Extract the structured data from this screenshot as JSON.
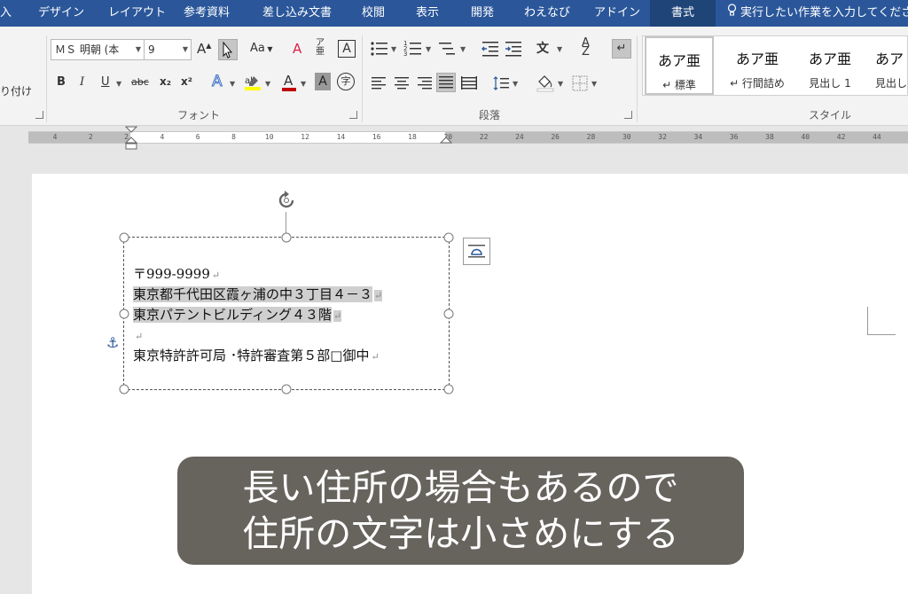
{
  "tabs": [
    "入",
    "デザイン",
    "レイアウト",
    "参考資料",
    "差し込み文書",
    "校閲",
    "表示",
    "開発",
    "わえなび",
    "アドイン",
    "書式"
  ],
  "tell_me": "実行したい作業を入力してください",
  "ribbon": {
    "paste_label": "り付け",
    "font_name": "ＭＳ 明朝 (本",
    "font_size": "9",
    "change_case": "Aa",
    "font_group_label": "フォント",
    "paragraph_group_label": "段落",
    "styles_group_label": "スタイル",
    "format_buttons": {
      "bold": "B",
      "italic": "I",
      "underline": "U",
      "strike": "abc",
      "subscript": "x₂",
      "superscript": "x²"
    },
    "styles": [
      {
        "sample": "あア亜",
        "name": "↵ 標準"
      },
      {
        "sample": "あア亜",
        "name": "↵ 行間詰め"
      },
      {
        "sample": "あア亜",
        "name": "見出し 1"
      },
      {
        "sample": "あア",
        "name": "見出し"
      }
    ]
  },
  "ruler": {
    "ticks": [
      "4",
      "2",
      "2",
      "4",
      "6",
      "8",
      "10",
      "12",
      "14",
      "16",
      "18",
      "20",
      "22",
      "24",
      "26",
      "28",
      "30",
      "32",
      "34",
      "36",
      "38",
      "40",
      "42",
      "44"
    ]
  },
  "textbox": {
    "lines": [
      "〒999-9999",
      "東京都千代田区霞ヶ浦の中３丁目４－３",
      "東京パテントビルディング４３階",
      "",
      "東京特許許可局 ･特許審査第５部□御中"
    ]
  },
  "caption": {
    "line1": "長い住所の場合もあるので",
    "line2": "住所の文字は小さめにする"
  }
}
